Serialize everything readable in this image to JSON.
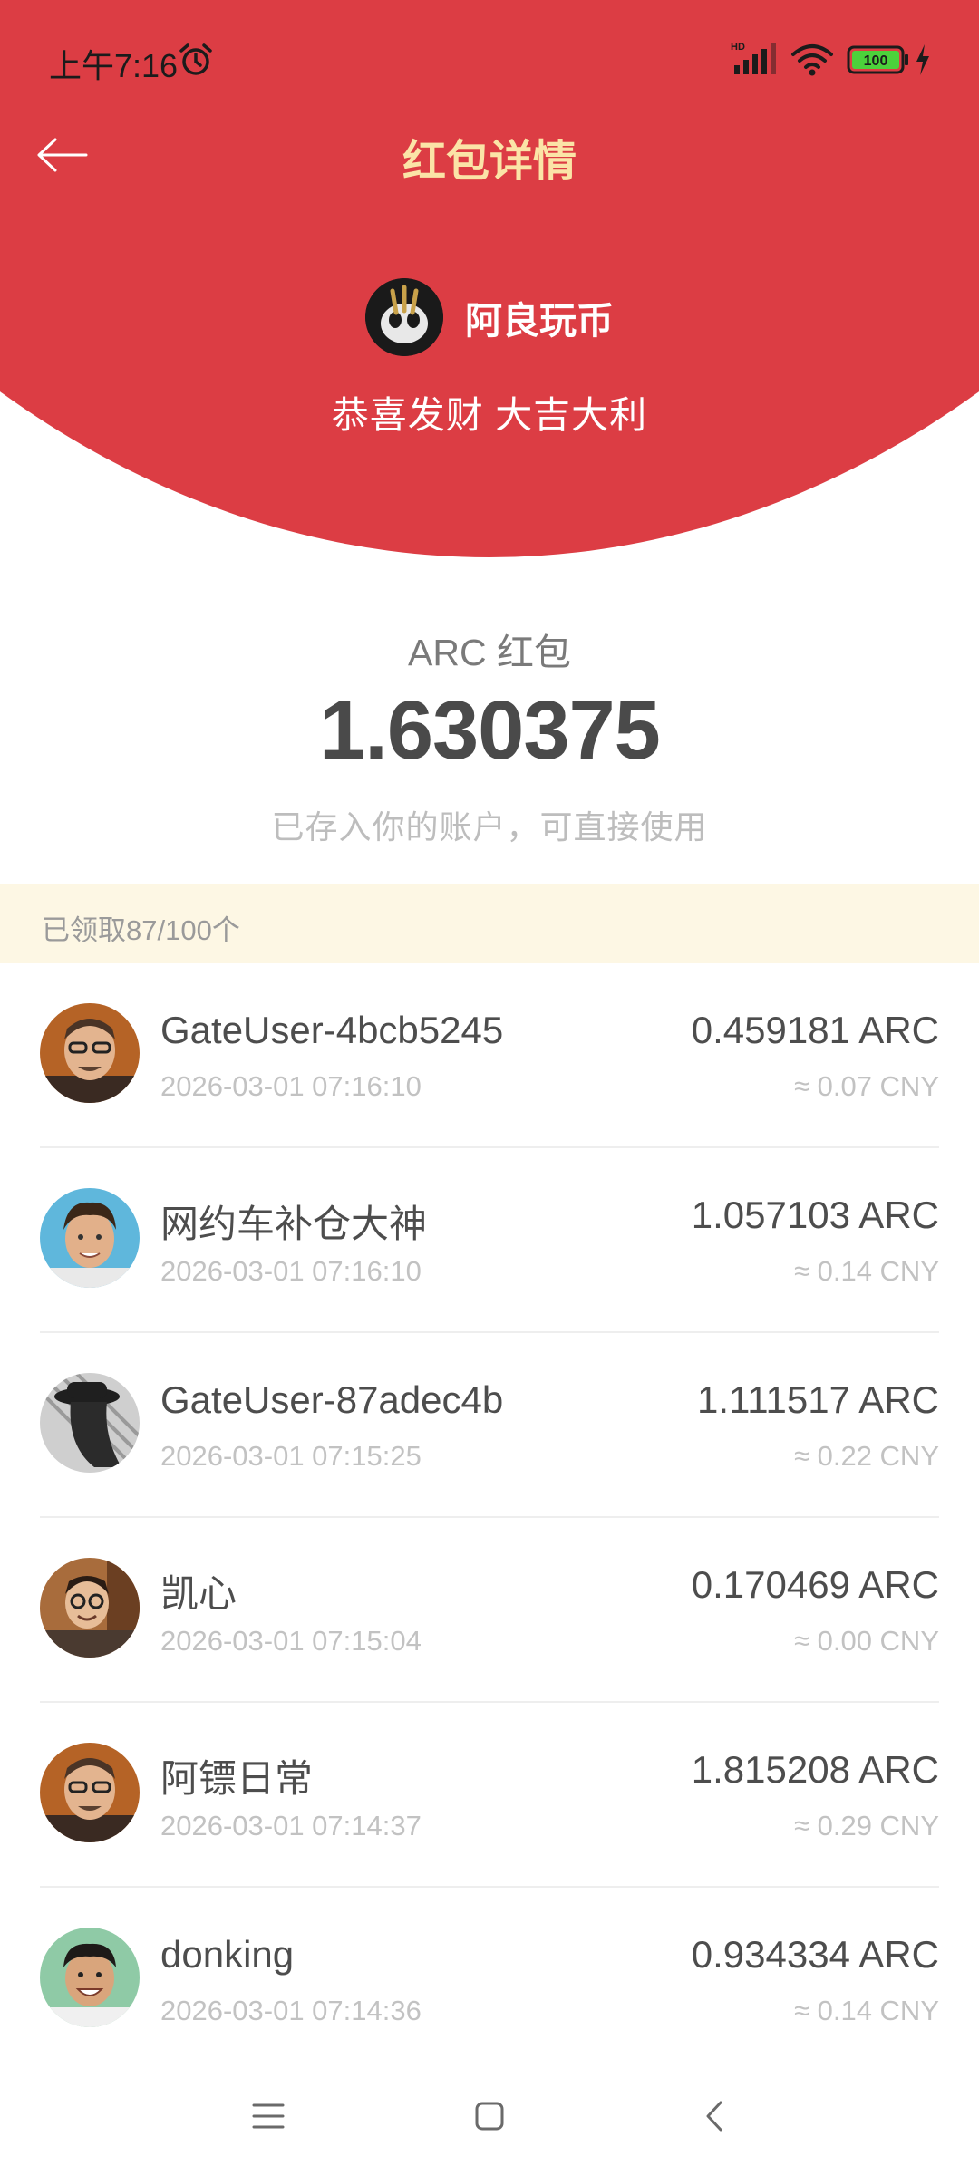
{
  "status_bar": {
    "time": "上午7:16",
    "battery": "100"
  },
  "header": {
    "title": "红包详情",
    "sender_name": "阿良玩币",
    "blessing": "恭喜发财 大吉大利"
  },
  "packet": {
    "coin_label": "ARC 红包",
    "amount": "1.630375",
    "note": "已存入你的账户，可直接使用"
  },
  "claimed": {
    "text": "已领取87/100个"
  },
  "claims": [
    {
      "name": "GateUser-4bcb5245",
      "time": "2026-03-01 07:16:10",
      "amount": "0.459181 ARC",
      "cny": "≈ 0.07 CNY"
    },
    {
      "name": "网约车补仓大神",
      "time": "2026-03-01 07:16:10",
      "amount": "1.057103 ARC",
      "cny": "≈ 0.14 CNY"
    },
    {
      "name": "GateUser-87adec4b",
      "time": "2026-03-01 07:15:25",
      "amount": "1.111517 ARC",
      "cny": "≈ 0.22 CNY"
    },
    {
      "name": "凯心",
      "time": "2026-03-01 07:15:04",
      "amount": "0.170469 ARC",
      "cny": "≈ 0.00 CNY"
    },
    {
      "name": "阿镖日常",
      "time": "2026-03-01 07:14:37",
      "amount": "1.815208 ARC",
      "cny": "≈ 0.29 CNY"
    },
    {
      "name": "donking",
      "time": "2026-03-01 07:14:36",
      "amount": "0.934334 ARC",
      "cny": "≈ 0.14 CNY"
    }
  ],
  "colors": {
    "header_red": "#dc3d44",
    "title_gold": "#fbe4a7",
    "claimed_bg": "#fdf7e4"
  }
}
